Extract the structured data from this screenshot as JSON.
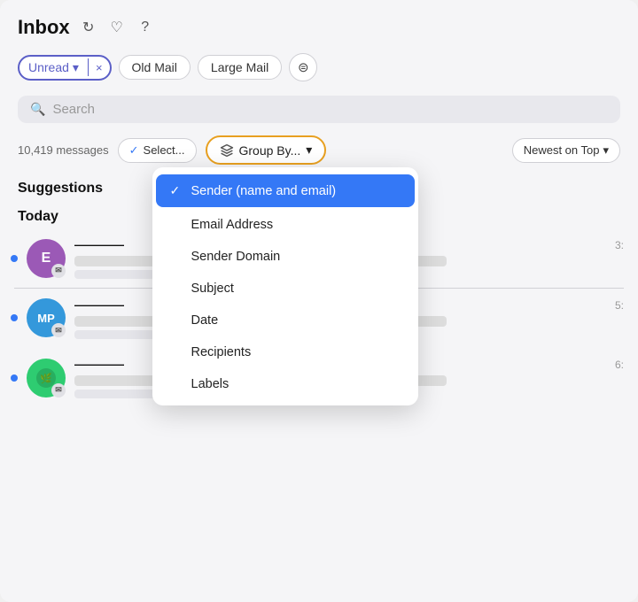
{
  "header": {
    "title": "Inbox",
    "refresh_label": "↻",
    "heart_label": "♡",
    "help_label": "?"
  },
  "filters": {
    "unread_label": "Unread",
    "unread_chevron": "▾",
    "close_label": "×",
    "old_mail_label": "Old Mail",
    "large_mail_label": "Large Mail",
    "filter_icon": "≡"
  },
  "search": {
    "placeholder": "Search"
  },
  "toolbar": {
    "message_count": "10,419 messages",
    "select_label": "Select...",
    "group_by_label": "Group By...",
    "newest_label": "Newest on Top"
  },
  "dropdown": {
    "items": [
      {
        "id": "sender",
        "label": "Sender (name and email)",
        "selected": true
      },
      {
        "id": "email",
        "label": "Email Address",
        "selected": false
      },
      {
        "id": "domain",
        "label": "Sender Domain",
        "selected": false
      },
      {
        "id": "subject",
        "label": "Subject",
        "selected": false
      },
      {
        "id": "date",
        "label": "Date",
        "selected": false
      },
      {
        "id": "recipients",
        "label": "Recipients",
        "selected": false
      },
      {
        "id": "labels",
        "label": "Labels",
        "selected": false
      }
    ]
  },
  "sections": {
    "suggestions_label": "Suggestions",
    "today_label": "Today"
  },
  "emails": [
    {
      "id": 1,
      "initials": "E",
      "color": "#9b59b6",
      "unread": true,
      "time": "3:"
    },
    {
      "id": 2,
      "initials": "MP",
      "color": "#3498db",
      "unread": true,
      "time": "5:"
    },
    {
      "id": 3,
      "initials": "",
      "color": "#2ecc71",
      "unread": true,
      "time": "6:"
    }
  ]
}
